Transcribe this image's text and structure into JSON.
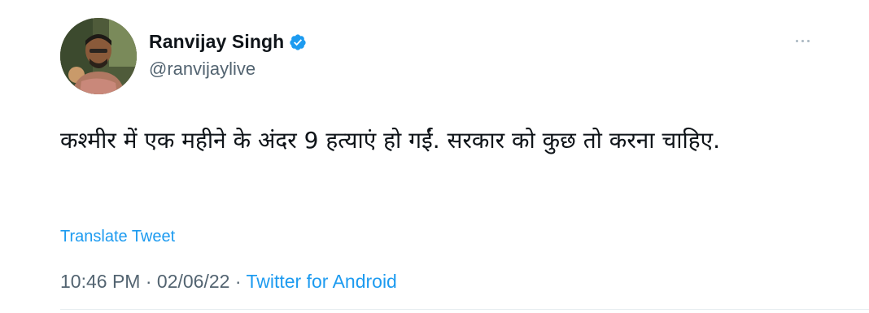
{
  "tweet": {
    "author": {
      "name": "Ranvijay Singh",
      "handle": "@ranvijaylive",
      "verified": true,
      "avatar_icon": "profile-photo"
    },
    "text": "कश्मीर में एक महीने के अंदर 9 हत्याएं हो गईं. सरकार को कुछ तो करना चाहिए.",
    "translate_label": "Translate Tweet",
    "time": "10:46 PM",
    "date": "02/06/22",
    "separator": "·",
    "source": "Twitter for Android",
    "more_icon": "more-options-icon"
  },
  "colors": {
    "accent": "#1d9bf0",
    "text_primary": "#0f1419",
    "text_secondary": "#536471"
  }
}
